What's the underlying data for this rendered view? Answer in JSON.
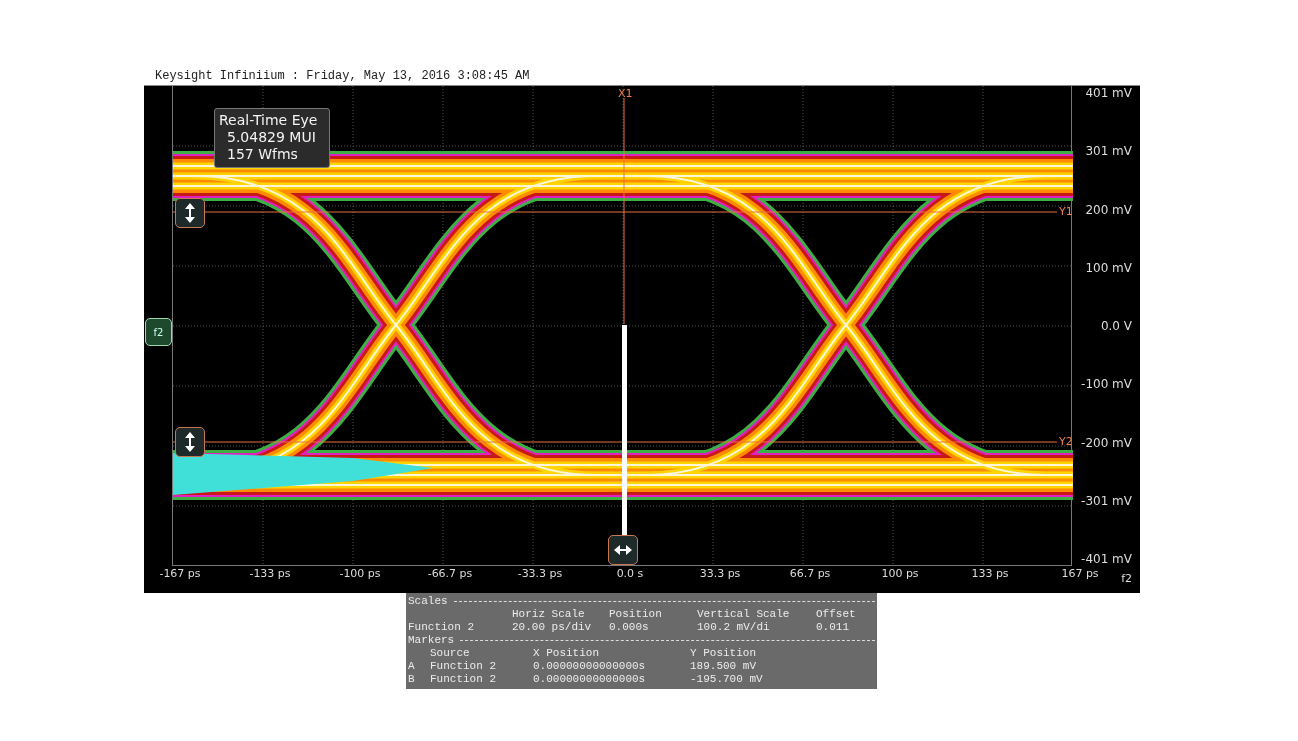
{
  "window": {
    "title": "Keysight Infiniium : Friday, May 13, 2016 3:08:45 AM"
  },
  "scope": {
    "info_box": [
      "Real-Time Eye",
      "5.04829 MUI",
      "157 Wfms"
    ],
    "cursors": [
      {
        "kind": "vertical",
        "label": "X1"
      },
      {
        "kind": "horizontal",
        "label": "Y1"
      },
      {
        "kind": "horizontal",
        "label": "Y2"
      }
    ],
    "waveform_tag": "f2",
    "y_axis_labels": [
      "401 mV",
      "301 mV",
      "200 mV",
      "100 mV",
      "0.0 V",
      "-100 mV",
      "-200 mV",
      "-301 mV",
      "-401 mV"
    ],
    "x_axis_labels": [
      "-167 ps",
      "-133 ps",
      "-100 ps",
      "-66.7 ps",
      "-33.3 ps",
      "0.0 s",
      "33.3 ps",
      "66.7 ps",
      "100 ps",
      "133 ps",
      "167 ps"
    ],
    "corner_label": "f2"
  },
  "scales": {
    "title": "Scales",
    "columns": [
      "",
      "Horiz Scale",
      "Position",
      "Vertical Scale",
      "Offset"
    ],
    "rows": [
      [
        "Function 2",
        "20.00 ps/div",
        "0.000s",
        "100.2 mV/di",
        "0.011"
      ]
    ]
  },
  "markers": {
    "title": "Markers",
    "columns": [
      "Source",
      "X Position",
      "Y Position"
    ],
    "rows": [
      {
        "id": "A",
        "source": "Function 2",
        "x_position": "0.00000000000000s",
        "y_position": "189.500 mV"
      },
      {
        "id": "B",
        "source": "Function 2",
        "x_position": "0.00000000000000s",
        "y_position": "-195.700 mV"
      }
    ]
  }
}
